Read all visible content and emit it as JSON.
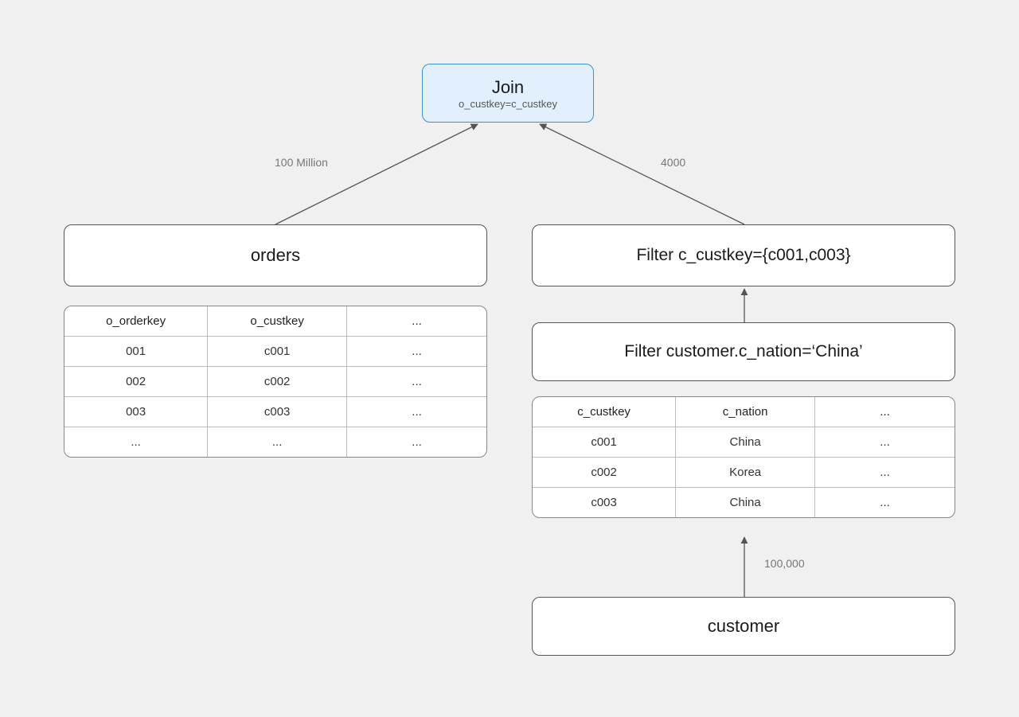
{
  "join": {
    "title": "Join",
    "condition": "o_custkey=c_custkey"
  },
  "edges": {
    "left_label": "100 Million",
    "right_label": "4000",
    "customer_label": "100,000"
  },
  "orders_node": {
    "title": "orders"
  },
  "filter_top": {
    "title": "Filter c_custkey={c001,c003}"
  },
  "filter_mid": {
    "title": "Filter customer.c_nation=‘China’"
  },
  "customer_node": {
    "title": "customer"
  },
  "orders_table": {
    "headers": [
      "o_orderkey",
      "o_custkey",
      "..."
    ],
    "rows": [
      [
        "001",
        "c001",
        "..."
      ],
      [
        "002",
        "c002",
        "..."
      ],
      [
        "003",
        "c003",
        "..."
      ],
      [
        "...",
        "...",
        "..."
      ]
    ]
  },
  "customer_table": {
    "headers": [
      "c_custkey",
      "c_nation",
      "..."
    ],
    "rows": [
      [
        "c001",
        "China",
        "..."
      ],
      [
        "c002",
        "Korea",
        "..."
      ],
      [
        "c003",
        "China",
        "..."
      ]
    ]
  }
}
